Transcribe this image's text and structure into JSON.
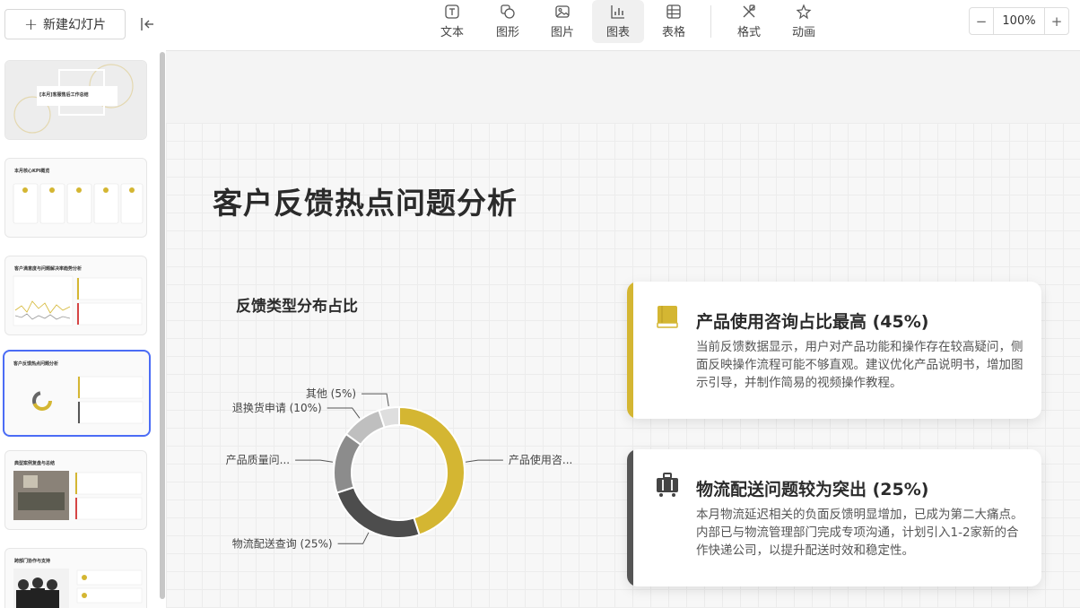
{
  "sidebar": {
    "new_slide_label": "新建幻灯片",
    "thumbnails": [
      {
        "title": "[本月]客服售后工作总结",
        "active": false
      },
      {
        "title": "本月核心KPI概览",
        "active": false
      },
      {
        "title": "客户满意度与问题解决率趋势分析",
        "active": false
      },
      {
        "title": "客户反馈热点问题分析",
        "active": true
      },
      {
        "title": "典型案例复盘与总结",
        "active": false
      },
      {
        "title": "跨部门协作与支持",
        "active": false
      }
    ]
  },
  "toolbar": {
    "tools": [
      {
        "label": "文本",
        "icon": "text-icon"
      },
      {
        "label": "图形",
        "icon": "shapes-icon"
      },
      {
        "label": "图片",
        "icon": "image-icon"
      },
      {
        "label": "图表",
        "icon": "chart-icon"
      },
      {
        "label": "表格",
        "icon": "table-icon"
      },
      {
        "label": "格式",
        "icon": "format-icon"
      },
      {
        "label": "动画",
        "icon": "animation-icon"
      }
    ],
    "active_tool": "图表",
    "zoom": {
      "minus": "−",
      "value": "100%",
      "plus": "+"
    }
  },
  "slide": {
    "title": "客户反馈热点问题分析",
    "chart_title": "反馈类型分布占比",
    "cards": [
      {
        "title": "产品使用咨询占比最高 (45%)",
        "body": "当前反馈数据显示，用户对产品功能和操作存在较高疑问，侧面反映操作流程可能不够直观。建议优化产品说明书，增加图示引导，并制作简易的视频操作教程。",
        "accent": "#d4b632",
        "icon": "book-icon"
      },
      {
        "title": "物流配送问题较为突出 (25%)",
        "body": "本月物流延迟相关的负面反馈明显增加，已成为第二大痛点。内部已与物流管理部门完成专项沟通，计划引入1-2家新的合作快递公司，以提升配送时效和稳定性。",
        "accent": "#555555",
        "icon": "luggage-icon"
      }
    ]
  },
  "chart_data": {
    "type": "pie",
    "title": "反馈类型分布占比",
    "categories": [
      "产品使用咨...",
      "物流配送查询 (25%)",
      "产品质量问...",
      "退换货申请 (10%)",
      "其他 (5%)"
    ],
    "values": [
      45,
      25,
      15,
      10,
      5
    ],
    "colors": [
      "#d4b632",
      "#4d4d4d",
      "#8c8c8c",
      "#bfbfbf",
      "#dedede"
    ],
    "donut": true
  }
}
